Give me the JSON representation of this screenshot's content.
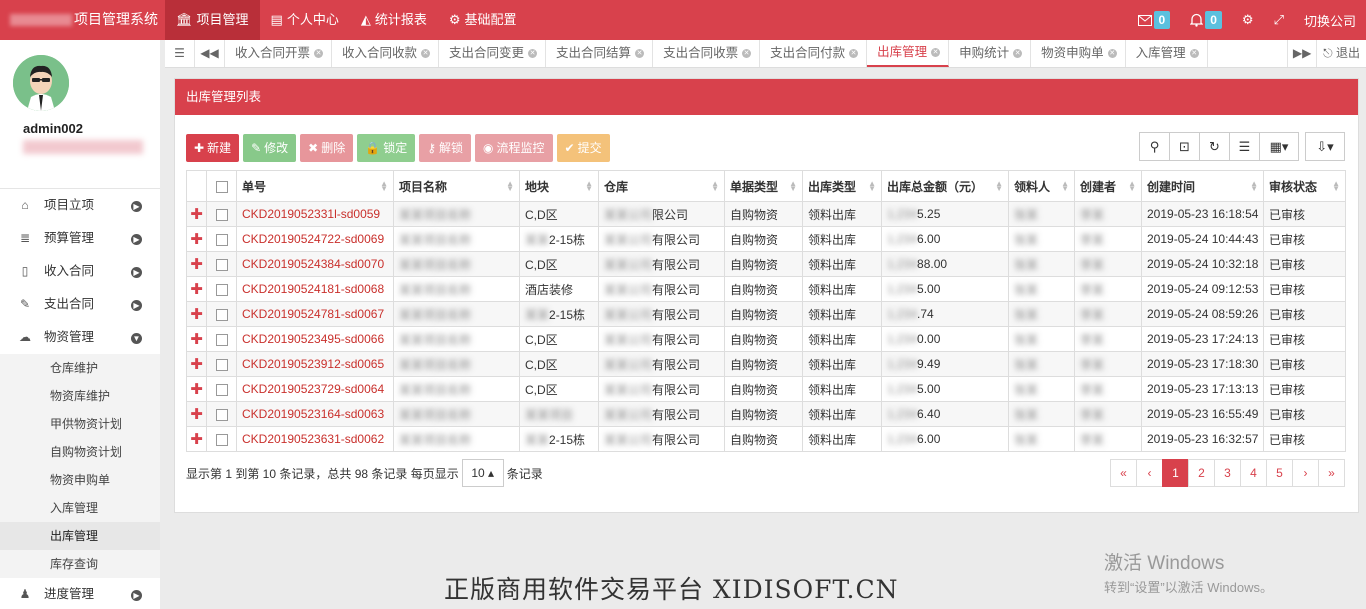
{
  "app": {
    "title": "项目管理系统"
  },
  "topnav": [
    {
      "icon": "bank-icon",
      "label": "项目管理",
      "active": true
    },
    {
      "icon": "profile-card-icon",
      "label": "个人中心",
      "active": false
    },
    {
      "icon": "area-chart-icon",
      "label": "统计报表",
      "active": false
    },
    {
      "icon": "gear-icon",
      "label": "基础配置",
      "active": false
    }
  ],
  "topright": {
    "mail_count": "0",
    "bell_count": "0",
    "switch_company": "切换公司"
  },
  "user": {
    "name": "admin002"
  },
  "sidebar": {
    "items": [
      {
        "icon": "home-icon",
        "label": "项目立项"
      },
      {
        "icon": "list-icon",
        "label": "预算管理"
      },
      {
        "icon": "document-icon",
        "label": "收入合同"
      },
      {
        "icon": "edit-icon",
        "label": "支出合同"
      },
      {
        "icon": "cloud-icon",
        "label": "物资管理",
        "expanded": true
      }
    ],
    "subitems": [
      "仓库维护",
      "物资库维护",
      "甲供物资计划",
      "自购物资计划",
      "物资申购单",
      "入库管理",
      "出库管理",
      "库存查询"
    ],
    "active_sub": "出库管理",
    "after": [
      {
        "icon": "user-icon",
        "label": "进度管理"
      }
    ]
  },
  "tabs": [
    "收入合同开票",
    "收入合同收款",
    "支出合同变更",
    "支出合同结算",
    "支出合同收票",
    "支出合同付款",
    "出库管理",
    "申购统计",
    "物资申购单",
    "入库管理"
  ],
  "active_tab": "出库管理",
  "tab_exit": "退出",
  "panel": {
    "title": "出库管理列表"
  },
  "toolbar": [
    {
      "label": "新建",
      "icon": "plus-icon",
      "style": "btn-red"
    },
    {
      "label": "修改",
      "icon": "edit-icon",
      "style": "btn-green"
    },
    {
      "label": "删除",
      "icon": "x-icon",
      "style": "btn-pink"
    },
    {
      "label": "锁定",
      "icon": "lock-icon",
      "style": "btn-lgreen"
    },
    {
      "label": "解锁",
      "icon": "key-icon",
      "style": "btn-lpink"
    },
    {
      "label": "流程监控",
      "icon": "eye-icon",
      "style": "btn-lpink"
    },
    {
      "label": "提交",
      "icon": "check-icon",
      "style": "btn-orange"
    }
  ],
  "table": {
    "columns": [
      "单号",
      "项目名称",
      "地块",
      "仓库",
      "单据类型",
      "出库类型",
      "出库总金额（元）",
      "领料人",
      "创建者",
      "创建时间",
      "审核状态"
    ],
    "rows": [
      {
        "code": "CKD2019052331l-sd0059",
        "project": "",
        "plot": "C,D区",
        "warehouse": "限公司",
        "doc_type": "自购物资",
        "out_type": "领料出库",
        "amount": "5.25",
        "picker": "",
        "creator": "",
        "created": "2019-05-23 16:18:54",
        "status": "已审核"
      },
      {
        "code": "CKD20190524722-sd0069",
        "project": "",
        "plot": "2-15栋",
        "warehouse": "有限公司",
        "doc_type": "自购物资",
        "out_type": "领料出库",
        "amount": "6.00",
        "picker": "",
        "creator": "",
        "created": "2019-05-24 10:44:43",
        "status": "已审核"
      },
      {
        "code": "CKD20190524384-sd0070",
        "project": "",
        "plot": "C,D区",
        "warehouse": "有限公司",
        "doc_type": "自购物资",
        "out_type": "领料出库",
        "amount": "88.00",
        "picker": "",
        "creator": "",
        "created": "2019-05-24 10:32:18",
        "status": "已审核"
      },
      {
        "code": "CKD20190524181-sd0068",
        "project": "",
        "plot": "酒店装修",
        "warehouse": "有限公司",
        "doc_type": "自购物资",
        "out_type": "领料出库",
        "amount": "5.00",
        "picker": "",
        "creator": "",
        "created": "2019-05-24 09:12:53",
        "status": "已审核"
      },
      {
        "code": "CKD20190524781-sd0067",
        "project": "",
        "plot": "2-15栋",
        "warehouse": "有限公司",
        "doc_type": "自购物资",
        "out_type": "领料出库",
        "amount": ".74",
        "picker": "",
        "creator": "",
        "created": "2019-05-24 08:59:26",
        "status": "已审核"
      },
      {
        "code": "CKD20190523495-sd0066",
        "project": "",
        "plot": "C,D区",
        "warehouse": "有限公司",
        "doc_type": "自购物资",
        "out_type": "领料出库",
        "amount": "0.00",
        "picker": "",
        "creator": "",
        "created": "2019-05-23 17:24:13",
        "status": "已审核"
      },
      {
        "code": "CKD20190523912-sd0065",
        "project": "",
        "plot": "C,D区",
        "warehouse": "有限公司",
        "doc_type": "自购物资",
        "out_type": "领料出库",
        "amount": "9.49",
        "picker": "",
        "creator": "",
        "created": "2019-05-23 17:18:30",
        "status": "已审核"
      },
      {
        "code": "CKD20190523729-sd0064",
        "project": "",
        "plot": "C,D区",
        "warehouse": "有限公司",
        "doc_type": "自购物资",
        "out_type": "领料出库",
        "amount": "5.00",
        "picker": "",
        "creator": "",
        "created": "2019-05-23 17:13:13",
        "status": "已审核"
      },
      {
        "code": "CKD20190523164-sd0063",
        "project": "",
        "plot": "",
        "warehouse": "有限公司",
        "doc_type": "自购物资",
        "out_type": "领料出库",
        "amount": "6.40",
        "picker": "",
        "creator": "",
        "created": "2019-05-23 16:55:49",
        "status": "已审核"
      },
      {
        "code": "CKD20190523631-sd0062",
        "project": "",
        "plot": "2-15栋",
        "warehouse": "有限公司",
        "doc_type": "自购物资",
        "out_type": "领料出库",
        "amount": "6.00",
        "picker": "",
        "creator": "",
        "created": "2019-05-23 16:32:57",
        "status": "已审核"
      }
    ]
  },
  "footer": {
    "summary": "显示第 1 到第 10 条记录，总共 98 条记录 每页显示",
    "page_size": "10",
    "suffix": "条记录"
  },
  "pager": [
    "«",
    "‹",
    "1",
    "2",
    "3",
    "4",
    "5",
    "›",
    "»"
  ],
  "pager_active": "1",
  "watermark": "正版商用软件交易平台 XIDISOFT.CN",
  "windows": {
    "line1": "激活 Windows",
    "line2": "转到“设置”以激活 Windows。"
  },
  "colors": {
    "brand": "#d8414c",
    "badge": "#5bc0de"
  }
}
